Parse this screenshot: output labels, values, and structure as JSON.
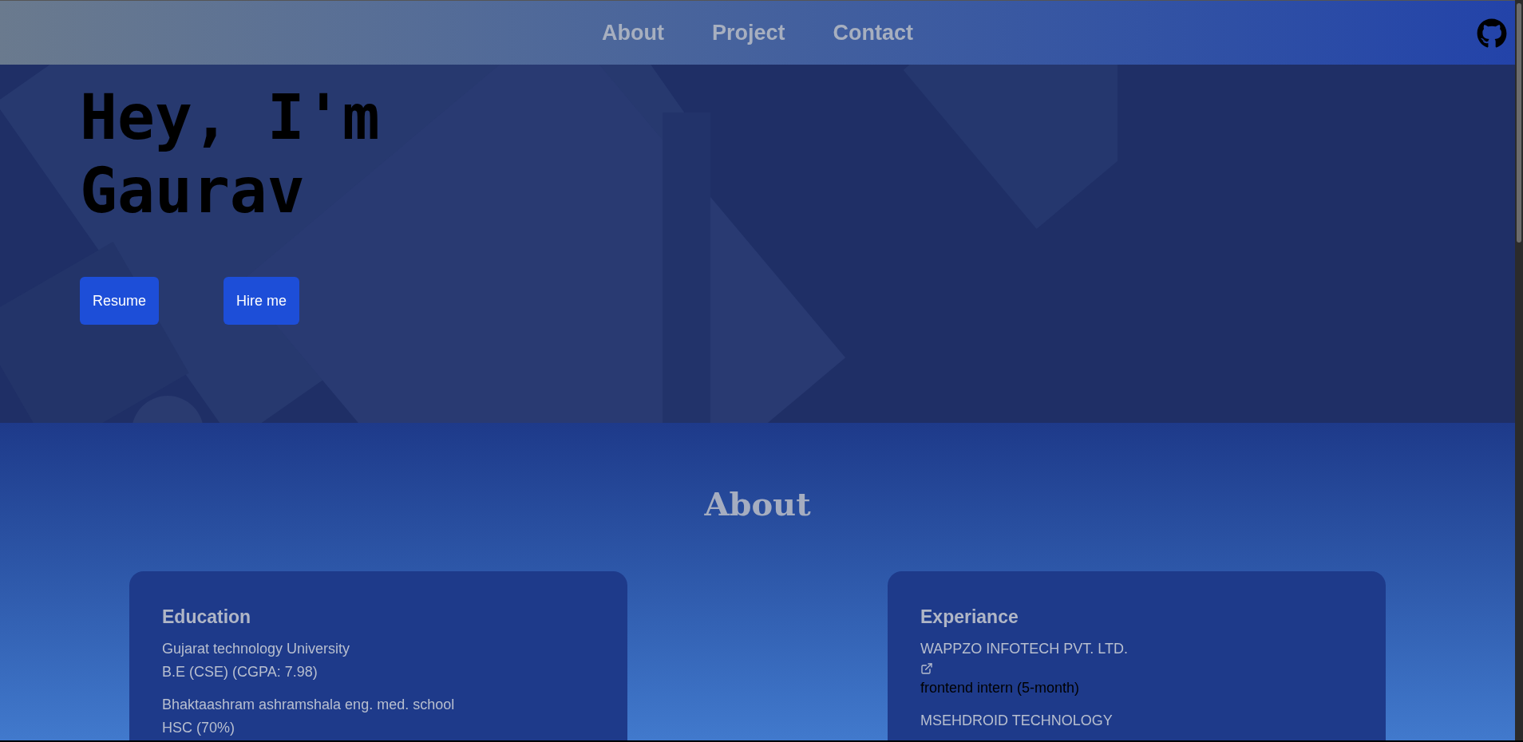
{
  "nav": {
    "links": [
      {
        "label": "About"
      },
      {
        "label": "Project"
      },
      {
        "label": "Contact"
      }
    ]
  },
  "hero": {
    "heading_lines": [
      "Hey, I'm",
      "Gaurav"
    ],
    "buttons": [
      "Resume",
      "Hire me"
    ]
  },
  "about": {
    "title": "About",
    "cards": [
      {
        "kind": "education",
        "title": "Education",
        "entries": [
          {
            "name": "Gujarat technology University",
            "detail": "B.E (CSE) (CGPA: 7.98)"
          },
          {
            "name": "Bhaktaashram ashramshala eng. med. school",
            "detail": "HSC (70%)"
          }
        ]
      },
      {
        "kind": "experience",
        "title": "Experiance",
        "entries": [
          {
            "name": "WAPPZO INFOTECH PVT. LTD.",
            "link": true,
            "detail": "frontend intern (5-month)"
          },
          {
            "name": "MSEHDROID TECHNOLOGY",
            "link": false
          }
        ]
      }
    ]
  }
}
